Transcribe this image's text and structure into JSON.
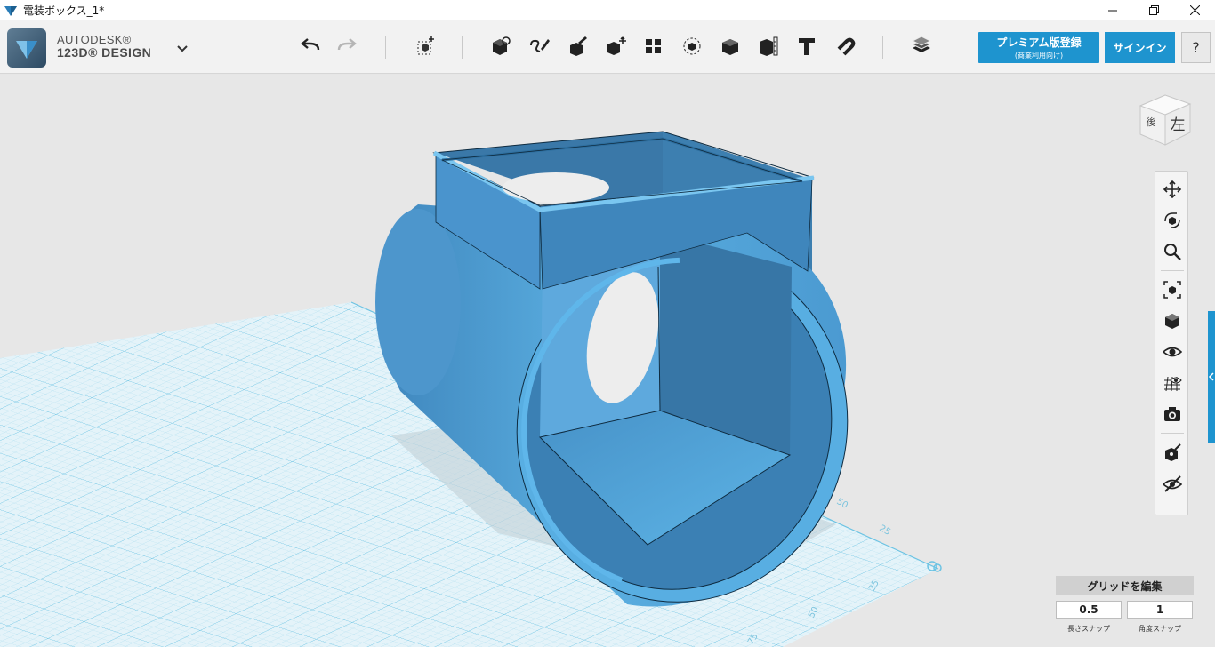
{
  "window": {
    "title": "電装ボックス_1*"
  },
  "brand": {
    "line1": "AUTODESK®",
    "line2": "123D® DESIGN"
  },
  "toolbar": {
    "undo": "undo-icon",
    "redo": "redo-icon",
    "tools": [
      "primitives",
      "sketch",
      "construct",
      "modify",
      "pattern",
      "group",
      "combine",
      "measure",
      "text",
      "snap",
      "materials"
    ]
  },
  "account": {
    "premium_label": "プレミアム版登録",
    "premium_sub": "(商業利用向け)",
    "signin_label": "サインイン",
    "help_label": "?"
  },
  "viewcube": {
    "face_label": "左",
    "side_label": "後"
  },
  "grid": {
    "edit_label": "グリッドを編集",
    "snap_length_value": "0.5",
    "snap_angle_value": "1",
    "snap_length_label": "長さスナップ",
    "snap_angle_label": "角度スナップ",
    "ruler_labels": [
      "50",
      "25",
      "25",
      "50",
      "75"
    ]
  },
  "colors": {
    "accent": "#1e94cf",
    "model": "#4a9fd6",
    "grid_line": "#7ecbe6"
  }
}
